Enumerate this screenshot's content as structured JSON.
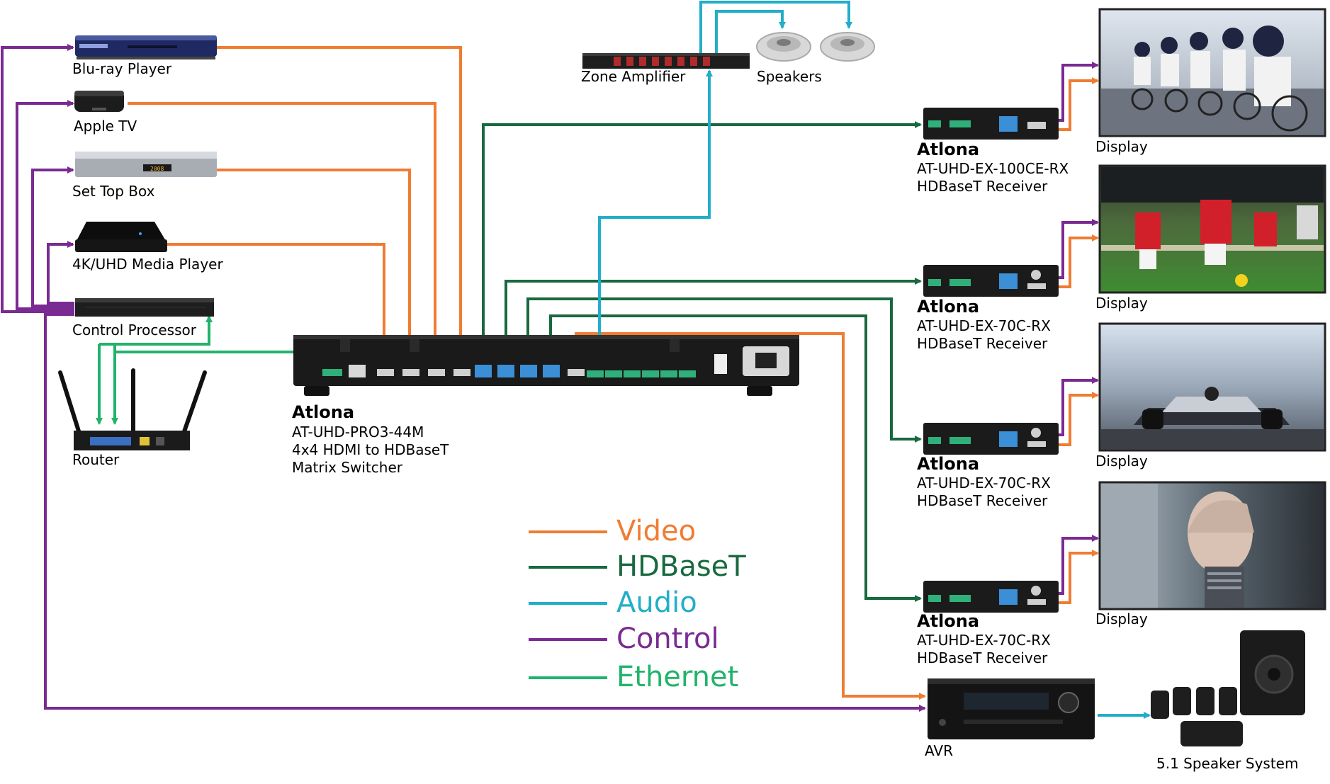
{
  "sources": {
    "bluray": "Blu-ray Player",
    "appletv": "Apple TV",
    "settop": "Set Top Box",
    "uhd_player": "4K/UHD Media Player",
    "control": "Control Processor",
    "router": "Router"
  },
  "zone_amp": "Zone Amplifier",
  "speakers": "Speakers",
  "switcher": {
    "brand": "Atlona",
    "model": "AT-UHD-PRO3-44M",
    "desc1": "4x4 HDMI to HDBaseT",
    "desc2": "Matrix Switcher"
  },
  "receivers": [
    {
      "brand": "Atlona",
      "model": "AT-UHD-EX-100CE-RX",
      "desc": "HDBaseT Receiver"
    },
    {
      "brand": "Atlona",
      "model": "AT-UHD-EX-70C-RX",
      "desc": "HDBaseT Receiver"
    },
    {
      "brand": "Atlona",
      "model": "AT-UHD-EX-70C-RX",
      "desc": "HDBaseT Receiver"
    },
    {
      "brand": "Atlona",
      "model": "AT-UHD-EX-70C-RX",
      "desc": "HDBaseT Receiver"
    }
  ],
  "displays": [
    "Display",
    "Display",
    "Display",
    "Display"
  ],
  "avr": "AVR",
  "speaker_system": "5.1 Speaker System",
  "legend": [
    {
      "label": "Video",
      "color": "#f07c32"
    },
    {
      "label": "HDBaseT",
      "color": "#19693f"
    },
    {
      "label": "Audio",
      "color": "#22aec8"
    },
    {
      "label": "Control",
      "color": "#7a2a93"
    },
    {
      "label": "Ethernet",
      "color": "#22b36b"
    }
  ],
  "colors": {
    "video": "#f07c32",
    "hdbaset": "#19693f",
    "audio": "#22aec8",
    "control": "#7a2a93",
    "ethernet": "#22b36b"
  }
}
